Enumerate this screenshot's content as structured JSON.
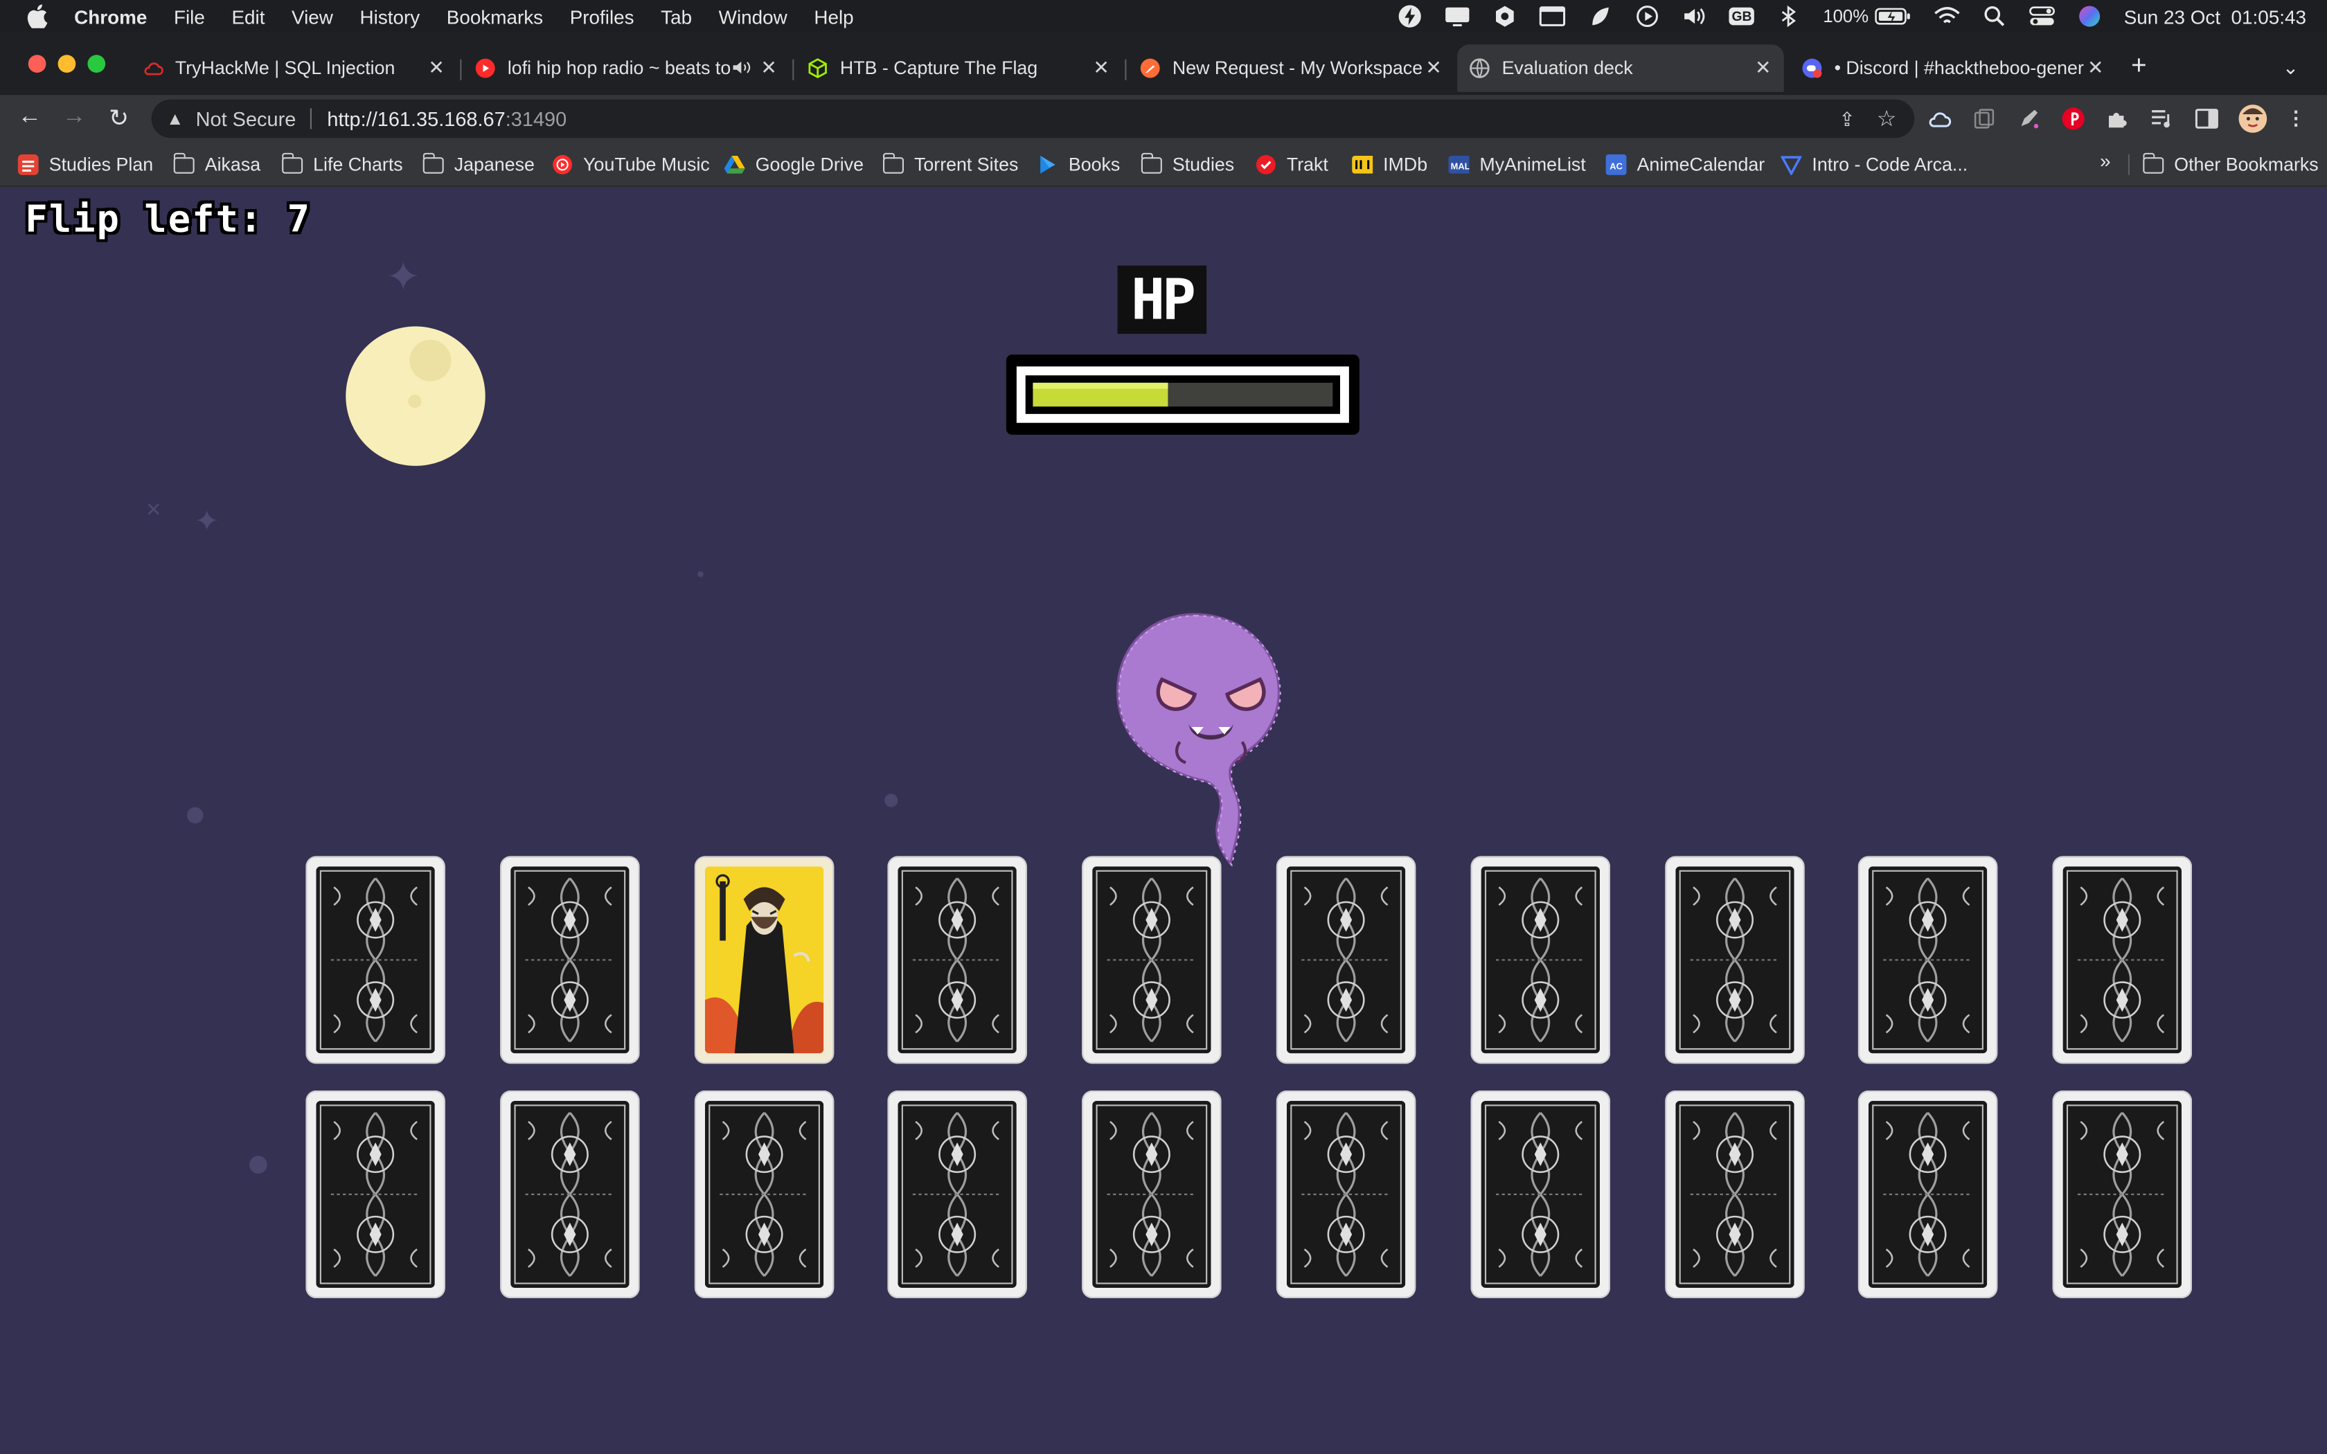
{
  "menubar": {
    "app": "Chrome",
    "items": [
      "File",
      "Edit",
      "View",
      "History",
      "Bookmarks",
      "Profiles",
      "Tab",
      "Window",
      "Help"
    ],
    "battery": "100%",
    "datetime": "Sun 23 Oct  01:05:43",
    "input_source": "GB"
  },
  "tabs": [
    {
      "title": "TryHackMe | SQL Injection",
      "icon": "cloud-icon",
      "color": "#d92b2b"
    },
    {
      "title": "lofi hip hop radio ~ beats to",
      "icon": "youtube-icon",
      "color": "#ff2b2b",
      "audio": true
    },
    {
      "title": "HTB - Capture The Flag",
      "icon": "htb-cube-icon",
      "color": "#9fef00"
    },
    {
      "title": "New Request - My Workspace",
      "icon": "postman-icon",
      "color": "#ff6c37"
    },
    {
      "title": "Evaluation deck",
      "icon": "globe-icon",
      "color": "#bdbdbd",
      "active": true
    },
    {
      "title": "• Discord | #hacktheboo-gener",
      "icon": "discord-icon",
      "color": "#5865f2"
    }
  ],
  "toolbar": {
    "security_label": "Not Secure",
    "url_host": "http://161.35.168.67",
    "url_port": ":31490"
  },
  "bookmarks": [
    {
      "label": "Studies Plan",
      "icon": "todoist-icon"
    },
    {
      "label": "Aikasa",
      "icon": "folder-icon"
    },
    {
      "label": "Life Charts",
      "icon": "folder-icon"
    },
    {
      "label": "Japanese",
      "icon": "folder-icon"
    },
    {
      "label": "YouTube Music",
      "icon": "youtube-music-icon"
    },
    {
      "label": "Google Drive",
      "icon": "google-drive-icon"
    },
    {
      "label": "Torrent Sites",
      "icon": "folder-icon"
    },
    {
      "label": "Books",
      "icon": "google-play-books-icon"
    },
    {
      "label": "Studies",
      "icon": "folder-icon"
    },
    {
      "label": "Trakt",
      "icon": "trakt-icon"
    },
    {
      "label": "IMDb",
      "icon": "imdb-icon"
    },
    {
      "label": "MyAnimeList",
      "icon": "mal-icon"
    },
    {
      "label": "AnimeCalendar",
      "icon": "animecalendar-icon"
    },
    {
      "label": "Intro - Code Arca...",
      "icon": "code-arcana-icon"
    }
  ],
  "bookmarks_overflow": "»",
  "other_bookmarks": "Other Bookmarks",
  "game": {
    "flip_text": "Flip left: 7",
    "hp_label": "HP",
    "hp_fraction": 0.45,
    "hp_fill_color": "#c6da38",
    "background_color": "#353152",
    "cards_rows": [
      [
        "back",
        "back",
        "face",
        "back",
        "back",
        "back",
        "back",
        "back",
        "back",
        "back"
      ],
      [
        "back",
        "back",
        "back",
        "back",
        "back",
        "back",
        "back",
        "back",
        "back",
        "back"
      ]
    ]
  }
}
